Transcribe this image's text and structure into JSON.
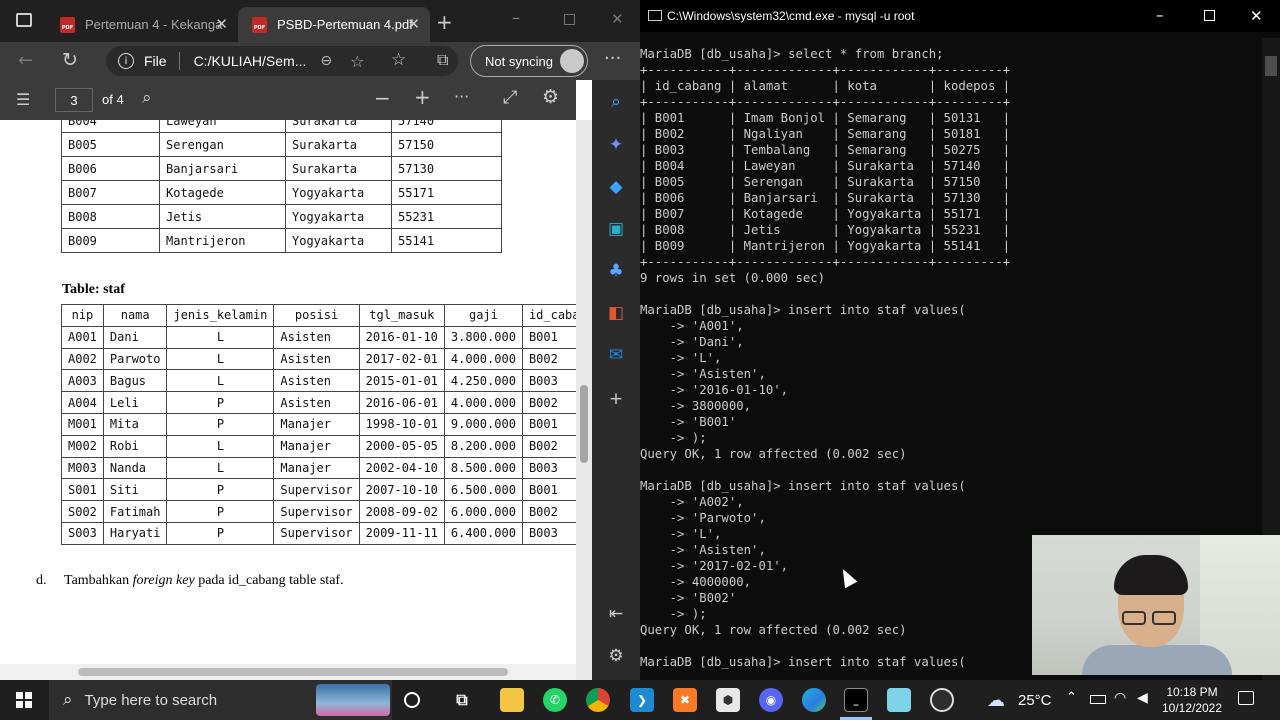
{
  "browser": {
    "tabs": [
      {
        "label": "Pertemuan 4 - Kekanga",
        "icon": "pdf-icon",
        "active": false
      },
      {
        "label": "PSBD-Pertemuan 4.pdf",
        "icon": "pdf-icon",
        "active": true
      }
    ],
    "address": {
      "scheme_label": "File",
      "url": "C:/KULIAH/Sem..."
    },
    "sync_label": "Not syncing",
    "pdf_toolbar": {
      "page_current": "3",
      "page_total": "of 4"
    }
  },
  "pdf": {
    "branch_rows": [
      [
        "B004",
        "Laweyan",
        "Surakarta",
        "57140"
      ],
      [
        "B005",
        "Serengan",
        "Surakarta",
        "57150"
      ],
      [
        "B006",
        "Banjarsari",
        "Surakarta",
        "57130"
      ],
      [
        "B007",
        "Kotagede",
        "Yogyakarta",
        "55171"
      ],
      [
        "B008",
        "Jetis",
        "Yogyakarta",
        "55231"
      ],
      [
        "B009",
        "Mantrijeron",
        "Yogyakarta",
        "55141"
      ]
    ],
    "staf_title": "Table: staf",
    "staf_headers": [
      "nip",
      "nama",
      "jenis_kelamin",
      "posisi",
      "tgl_masuk",
      "gaji",
      "id_cabang"
    ],
    "staf_rows": [
      [
        "A001",
        "Dani",
        "L",
        "Asisten",
        "2016-01-10",
        "3.800.000",
        "B001"
      ],
      [
        "A002",
        "Parwoto",
        "L",
        "Asisten",
        "2017-02-01",
        "4.000.000",
        "B002"
      ],
      [
        "A003",
        "Bagus",
        "L",
        "Asisten",
        "2015-01-01",
        "4.250.000",
        "B003"
      ],
      [
        "A004",
        "Leli",
        "P",
        "Asisten",
        "2016-06-01",
        "4.000.000",
        "B002"
      ],
      [
        "M001",
        "Mita",
        "P",
        "Manajer",
        "1998-10-01",
        "9.000.000",
        "B001"
      ],
      [
        "M002",
        "Robi",
        "L",
        "Manajer",
        "2000-05-05",
        "8.200.000",
        "B002"
      ],
      [
        "M003",
        "Nanda",
        "L",
        "Manajer",
        "2002-04-10",
        "8.500.000",
        "B003"
      ],
      [
        "S001",
        "Siti",
        "P",
        "Supervisor",
        "2007-10-10",
        "6.500.000",
        "B001"
      ],
      [
        "S002",
        "Fatimah",
        "P",
        "Supervisor",
        "2008-09-02",
        "6.000.000",
        "B002"
      ],
      [
        "S003",
        "Haryati",
        "P",
        "Supervisor",
        "2009-11-11",
        "6.400.000",
        "B003"
      ]
    ],
    "task": {
      "marker": "d.",
      "before": "Tambahkan ",
      "emphasis": "foreign key",
      "after": " pada id_cabang table staf."
    }
  },
  "terminal": {
    "title": "C:\\Windows\\system32\\cmd.exe - mysql  -u root",
    "lines": [
      "MariaDB [db_usaha]> select * from branch;",
      "+-----------+-------------+------------+---------+",
      "| id_cabang | alamat      | kota       | kodepos |",
      "+-----------+-------------+------------+---------+",
      "| B001      | Imam Bonjol | Semarang   | 50131   |",
      "| B002      | Ngaliyan    | Semarang   | 50181   |",
      "| B003      | Tembalang   | Semarang   | 50275   |",
      "| B004      | Laweyan     | Surakarta  | 57140   |",
      "| B005      | Serengan    | Surakarta  | 57150   |",
      "| B006      | Banjarsari  | Surakarta  | 57130   |",
      "| B007      | Kotagede    | Yogyakarta | 55171   |",
      "| B008      | Jetis       | Yogyakarta | 55231   |",
      "| B009      | Mantrijeron | Yogyakarta | 55141   |",
      "+-----------+-------------+------------+---------+",
      "9 rows in set (0.000 sec)",
      "",
      "MariaDB [db_usaha]> insert into staf values(",
      "    -> 'A001',",
      "    -> 'Dani',",
      "    -> 'L',",
      "    -> 'Asisten',",
      "    -> '2016-01-10',",
      "    -> 3800000,",
      "    -> 'B001'",
      "    -> );",
      "Query OK, 1 row affected (0.002 sec)",
      "",
      "MariaDB [db_usaha]> insert into staf values(",
      "    -> 'A002',",
      "    -> 'Parwoto',",
      "    -> 'L',",
      "    -> 'Asisten',",
      "    -> '2017-02-01',",
      "    -> 4000000,",
      "    -> 'B002'",
      "    -> );",
      "Query OK, 1 row affected (0.002 sec)",
      "",
      "MariaDB [db_usaha]> insert into staf values("
    ]
  },
  "taskbar": {
    "search_placeholder": "Type here to search",
    "weather": "25°C",
    "time": "10:18 PM",
    "date": "10/12/2022"
  },
  "colors": {
    "browser_chrome": "#3b3b3b",
    "tabbar": "#202020",
    "terminal_bg": "#0c0c0c",
    "terminal_text": "#cccccc",
    "taskbar": "#1f1f1f"
  }
}
